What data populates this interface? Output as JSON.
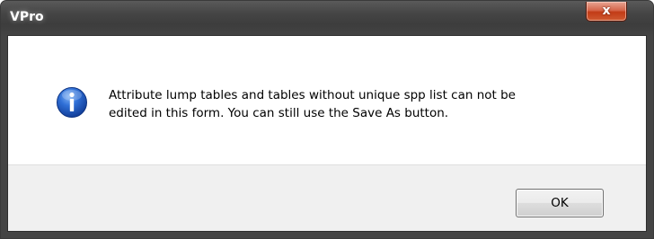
{
  "window": {
    "title": "VPro",
    "close_label": "x"
  },
  "dialog": {
    "icon": "information-icon",
    "message": "Attribute lump tables and tables without unique spp list can not be\nedited in this form.  You can still use the Save As button.",
    "ok_label": "OK"
  },
  "colors": {
    "title_bar": "#454545",
    "close_button": "#c23b16",
    "button_area": "#f0f0f0",
    "info_icon": "#1f5fc9"
  }
}
